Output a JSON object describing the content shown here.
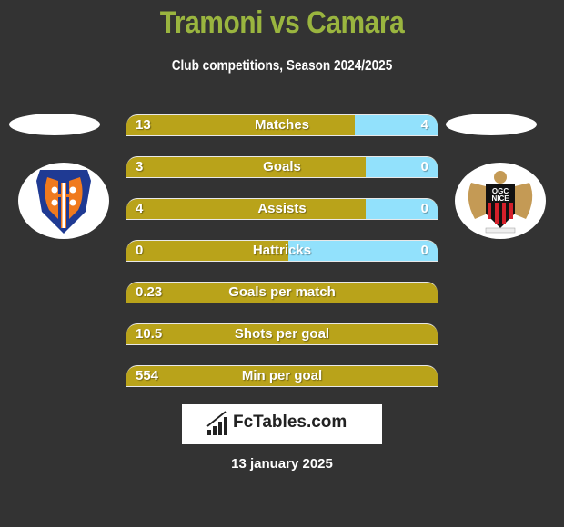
{
  "header": {
    "title": "Tramoni vs Camara",
    "subtitle": "Club competitions, Season 2024/2025"
  },
  "teams": {
    "left": {
      "logo_icon": "tampere-united-crest-icon",
      "colors": [
        "#1f3a93",
        "#f07a1e"
      ]
    },
    "right": {
      "logo_icon": "ogc-nice-crest-icon",
      "logo_text_top": "OGC",
      "logo_text_bottom": "NICE"
    }
  },
  "colors": {
    "left_bar": "#b9a31a",
    "right_bar": "#92e1fc",
    "title": "#9ab53f",
    "background": "#333333"
  },
  "stats": [
    {
      "label": "Matches",
      "left": "13",
      "right": "4",
      "right_share": 0.265
    },
    {
      "label": "Goals",
      "left": "3",
      "right": "0",
      "right_share": 0.23
    },
    {
      "label": "Assists",
      "left": "4",
      "right": "0",
      "right_share": 0.23
    },
    {
      "label": "Hattricks",
      "left": "0",
      "right": "0",
      "right_share": 0.48
    },
    {
      "label": "Goals per match",
      "left": "0.23",
      "right": null,
      "right_share": 0
    },
    {
      "label": "Shots per goal",
      "left": "10.5",
      "right": null,
      "right_share": 0
    },
    {
      "label": "Min per goal",
      "left": "554",
      "right": null,
      "right_share": 0
    }
  ],
  "brand": {
    "name": "FcTables.com",
    "icon": "bar-chart-icon"
  },
  "footer": {
    "date": "13 january 2025"
  }
}
